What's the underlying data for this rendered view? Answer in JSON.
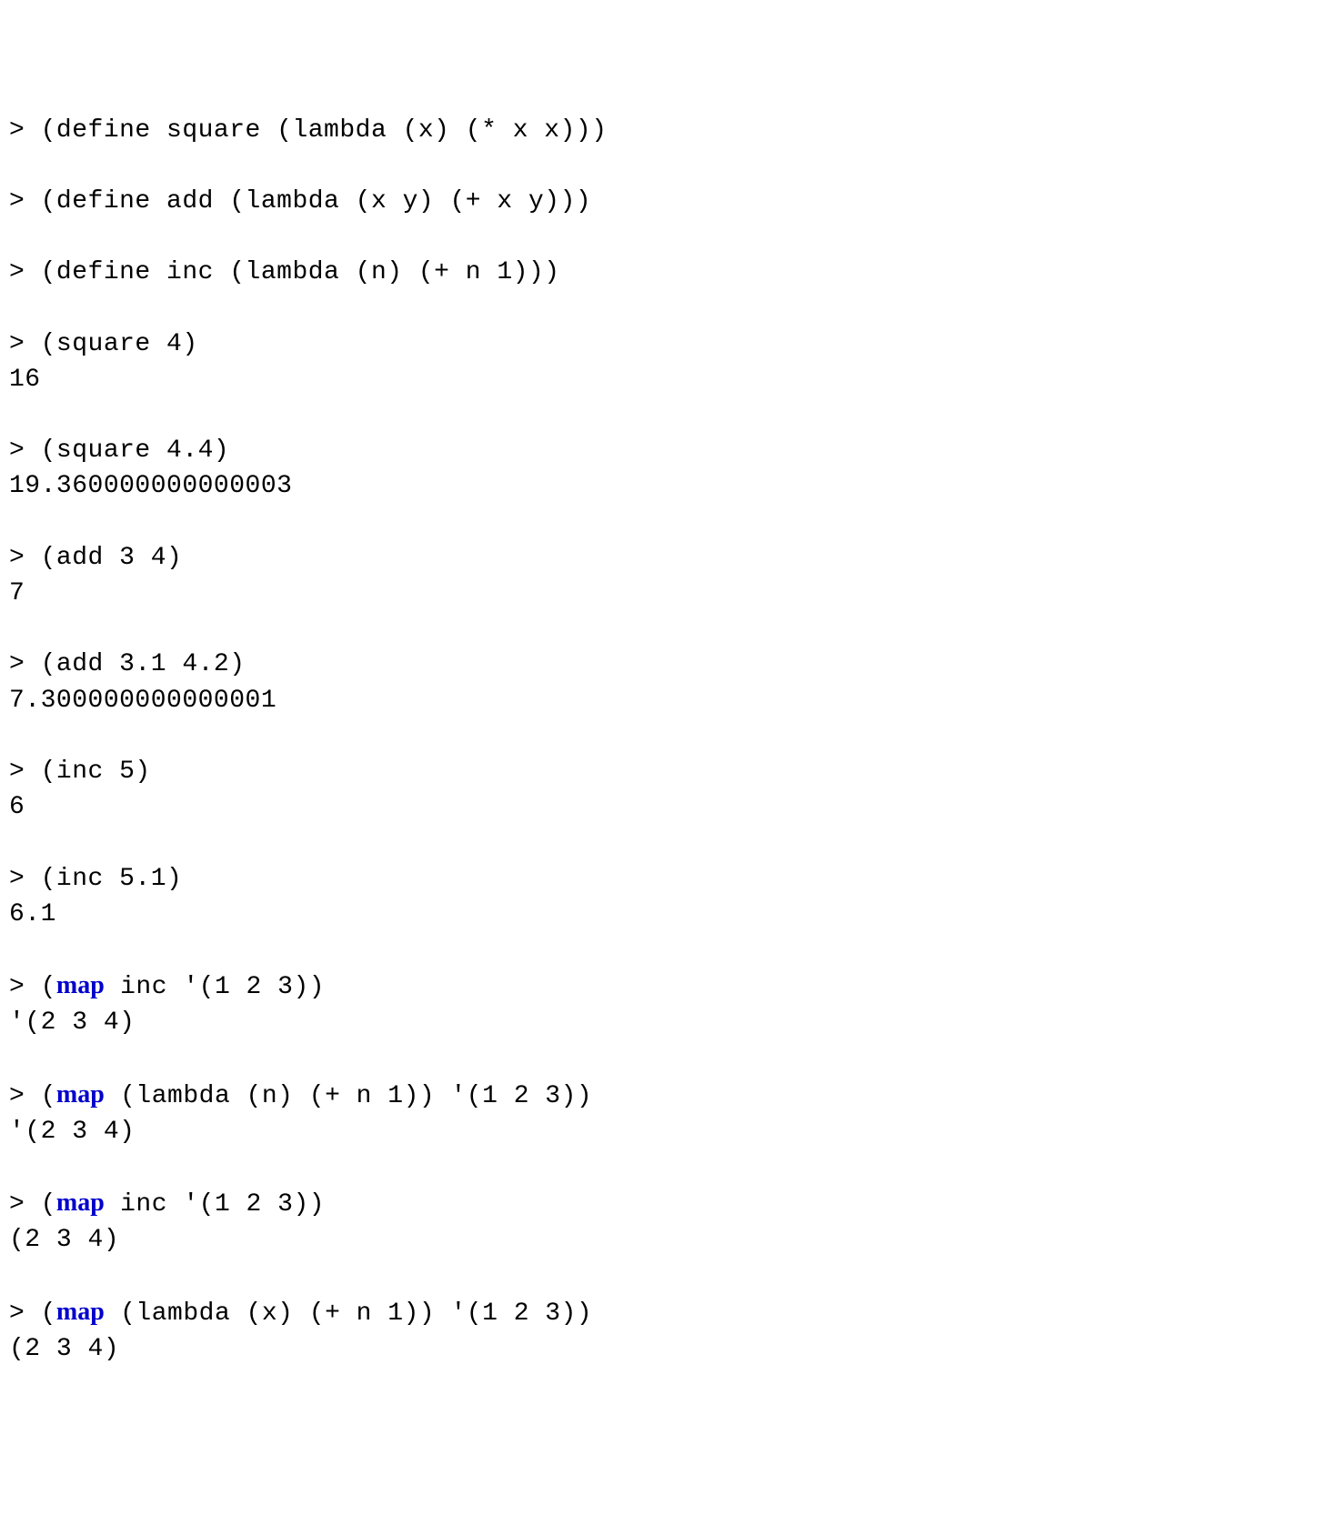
{
  "lines": [
    {
      "type": "prompt",
      "segments": [
        {
          "t": "> (define square (lambda (x) (* x x)))"
        }
      ]
    },
    {
      "type": "blank"
    },
    {
      "type": "prompt",
      "segments": [
        {
          "t": "> (define add (lambda (x y) (+ x y)))"
        }
      ]
    },
    {
      "type": "blank"
    },
    {
      "type": "prompt",
      "segments": [
        {
          "t": "> (define inc (lambda (n) (+ n 1)))"
        }
      ]
    },
    {
      "type": "blank"
    },
    {
      "type": "prompt",
      "segments": [
        {
          "t": "> (square 4)"
        }
      ]
    },
    {
      "type": "output",
      "segments": [
        {
          "t": "16"
        }
      ]
    },
    {
      "type": "blank"
    },
    {
      "type": "prompt",
      "segments": [
        {
          "t": "> (square 4.4)"
        }
      ]
    },
    {
      "type": "output",
      "segments": [
        {
          "t": "19.360000000000003"
        }
      ]
    },
    {
      "type": "blank"
    },
    {
      "type": "prompt",
      "segments": [
        {
          "t": "> (add 3 4)"
        }
      ]
    },
    {
      "type": "output",
      "segments": [
        {
          "t": "7"
        }
      ]
    },
    {
      "type": "blank"
    },
    {
      "type": "prompt",
      "segments": [
        {
          "t": "> (add 3.1 4.2)"
        }
      ]
    },
    {
      "type": "output",
      "segments": [
        {
          "t": "7.300000000000001"
        }
      ]
    },
    {
      "type": "blank"
    },
    {
      "type": "prompt",
      "segments": [
        {
          "t": "> (inc 5)"
        }
      ]
    },
    {
      "type": "output",
      "segments": [
        {
          "t": "6"
        }
      ]
    },
    {
      "type": "blank"
    },
    {
      "type": "prompt",
      "segments": [
        {
          "t": "> (inc 5.1)"
        }
      ]
    },
    {
      "type": "output",
      "segments": [
        {
          "t": "6.1"
        }
      ]
    },
    {
      "type": "blank"
    },
    {
      "type": "prompt",
      "segments": [
        {
          "t": "> ("
        },
        {
          "t": "map",
          "kw": true
        },
        {
          "t": " inc '(1 2 3))"
        }
      ]
    },
    {
      "type": "output",
      "segments": [
        {
          "t": "'(2 3 4)"
        }
      ]
    },
    {
      "type": "blank"
    },
    {
      "type": "prompt",
      "segments": [
        {
          "t": "> ("
        },
        {
          "t": "map",
          "kw": true
        },
        {
          "t": " (lambda (n) (+ n 1)) '(1 2 3))"
        }
      ]
    },
    {
      "type": "output",
      "segments": [
        {
          "t": "'(2 3 4)"
        }
      ]
    },
    {
      "type": "blank"
    },
    {
      "type": "prompt",
      "segments": [
        {
          "t": "> ("
        },
        {
          "t": "map",
          "kw": true
        },
        {
          "t": " inc '(1 2 3))"
        }
      ]
    },
    {
      "type": "output",
      "segments": [
        {
          "t": "(2 3 4)"
        }
      ]
    },
    {
      "type": "blank"
    },
    {
      "type": "prompt",
      "segments": [
        {
          "t": "> ("
        },
        {
          "t": "map",
          "kw": true
        },
        {
          "t": " (lambda (x) (+ n 1)) '(1 2 3))"
        }
      ]
    },
    {
      "type": "output",
      "segments": [
        {
          "t": "(2 3 4)"
        }
      ]
    }
  ]
}
